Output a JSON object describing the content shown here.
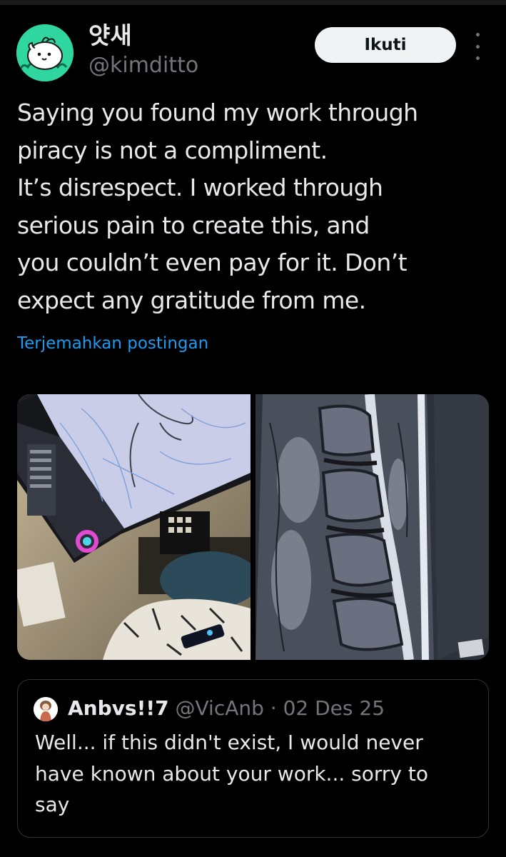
{
  "post": {
    "display_name": "얏새",
    "handle": "@kimditto",
    "follow_label": "Ikuti",
    "more_icon": "more-vertical-icon",
    "text_lines": [
      "Saying you found my work through",
      "piracy is not a compliment.",
      "It’s disrespect. I worked through",
      "serious pain to create this, and",
      "you couldn’t even pay for it. Don’t",
      "expect any gratitude from me."
    ],
    "translate_label": "Terjemahkan postingan",
    "media": [
      {
        "icon": "drawing-tablet-photo"
      },
      {
        "icon": "spine-mri-photo"
      }
    ]
  },
  "quote": {
    "display_name": "Anbvs!!7",
    "handle_and_date": "@VicAnb · 02 Des 25",
    "text_lines": [
      "Well... if this didn't exist, I would never",
      "have known about your work... sorry to",
      "say"
    ]
  },
  "colors": {
    "background": "#000000",
    "text": "#e7e9ea",
    "secondary": "#71767b",
    "link": "#1d9bf0",
    "follow_button_bg": "#eff3f4",
    "avatar_bg": "#2fd69f"
  }
}
